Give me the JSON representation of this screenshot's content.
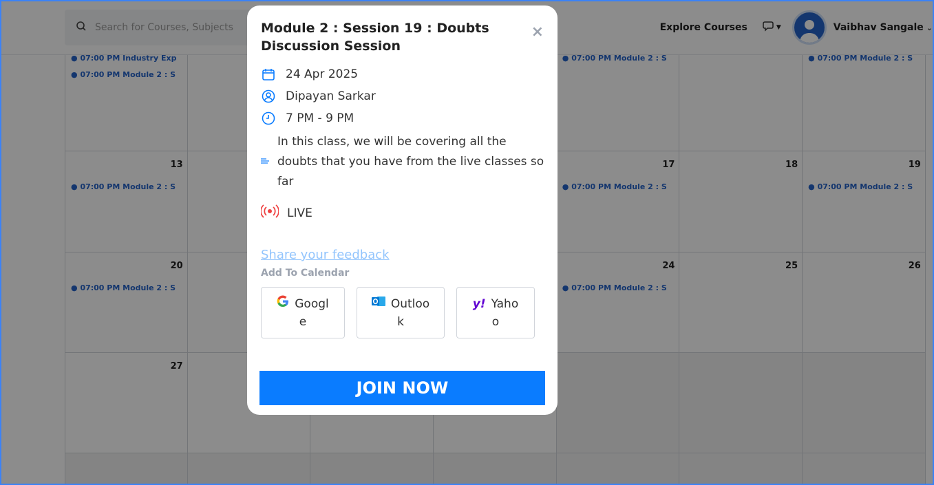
{
  "search": {
    "placeholder": "Search for Courses, Subjects"
  },
  "header": {
    "explore": "Explore Courses",
    "username": "Vaibhav Sangale"
  },
  "calendar": {
    "event_label": "07:00 PM Module 2 : S",
    "row1": {
      "partial_event": "07:00 PM Industry Exp"
    },
    "row2": {
      "d13": "13",
      "d17": "17",
      "d18": "18",
      "d19": "19"
    },
    "row3": {
      "d20": "20",
      "d24": "24",
      "d25": "25",
      "d26": "26"
    },
    "row4": {
      "d27": "27"
    }
  },
  "modal": {
    "title": "Module 2 : Session 19 : Doubts Discussion Session",
    "close": "×",
    "date": "24 Apr 2025",
    "instructor": "Dipayan Sarkar",
    "time": "7 PM - 9 PM",
    "description": "In this class, we will be covering all the doubts that you have from the live classes so far",
    "status": "LIVE",
    "feedback": "Share your feedback",
    "add_to_calendar": "Add To Calendar",
    "google_1": "Googl",
    "google_2": "e",
    "outlook_1": "Outloo",
    "outlook_2": "k",
    "yahoo_1": "Yaho",
    "yahoo_2": "o",
    "join": "JOIN NOW"
  },
  "colors": {
    "accent": "#0a7cff",
    "event": "#2563c9",
    "live": "#ef4444"
  }
}
